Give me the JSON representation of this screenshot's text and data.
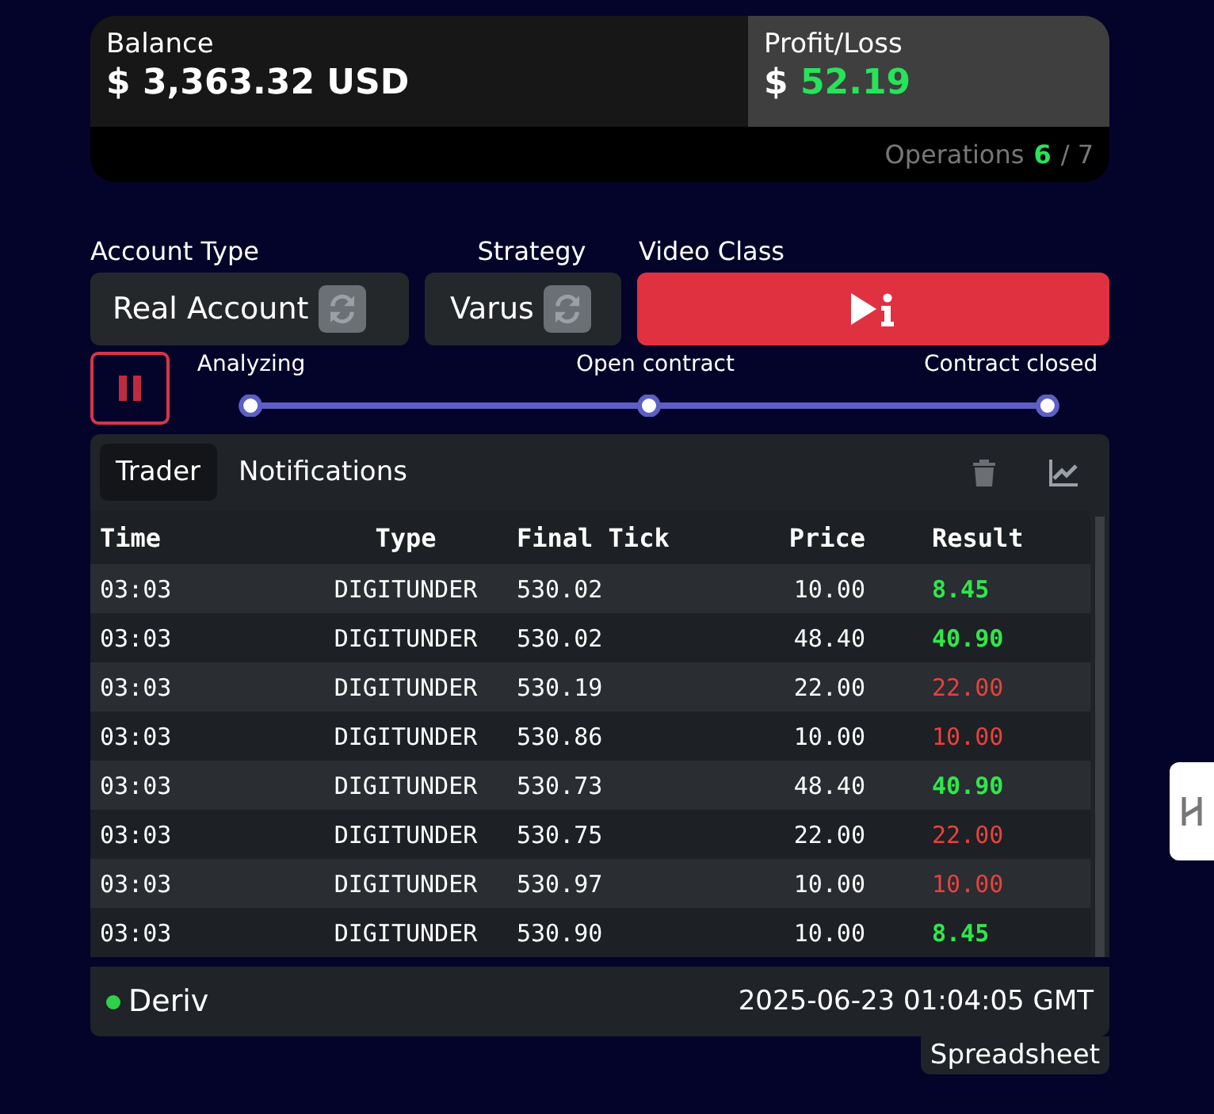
{
  "balance": {
    "label": "Balance",
    "value": "$ 3,363.32 USD"
  },
  "profit": {
    "label": "Profit/Loss",
    "currency": "$",
    "value": "52.19"
  },
  "operations": {
    "label": "Operations",
    "done": "6",
    "total": "/ 7"
  },
  "account_type": {
    "label": "Account Type",
    "value": "Real Account"
  },
  "strategy": {
    "label": "Strategy",
    "value": "Varus"
  },
  "video_class": {
    "label": "Video Class"
  },
  "progress": {
    "steps": [
      "Analyzing",
      "Open contract",
      "Contract closed"
    ]
  },
  "tabs": [
    {
      "label": "Trader",
      "selected": true
    },
    {
      "label": "Notifications",
      "selected": false
    }
  ],
  "table": {
    "columns": [
      "Time",
      "Type",
      "Final Tick",
      "Price",
      "Result"
    ],
    "rows": [
      {
        "time": "03:03",
        "type": "DIGITUNDER",
        "tick": "530.02",
        "price": "10.00",
        "result": "8.45",
        "kind": "win"
      },
      {
        "time": "03:03",
        "type": "DIGITUNDER",
        "tick": "530.02",
        "price": "48.40",
        "result": "40.90",
        "kind": "win"
      },
      {
        "time": "03:03",
        "type": "DIGITUNDER",
        "tick": "530.19",
        "price": "22.00",
        "result": "22.00",
        "kind": "loss"
      },
      {
        "time": "03:03",
        "type": "DIGITUNDER",
        "tick": "530.86",
        "price": "10.00",
        "result": "10.00",
        "kind": "loss"
      },
      {
        "time": "03:03",
        "type": "DIGITUNDER",
        "tick": "530.73",
        "price": "48.40",
        "result": "40.90",
        "kind": "win"
      },
      {
        "time": "03:03",
        "type": "DIGITUNDER",
        "tick": "530.75",
        "price": "22.00",
        "result": "22.00",
        "kind": "loss"
      },
      {
        "time": "03:03",
        "type": "DIGITUNDER",
        "tick": "530.97",
        "price": "10.00",
        "result": "10.00",
        "kind": "loss"
      },
      {
        "time": "03:03",
        "type": "DIGITUNDER",
        "tick": "530.90",
        "price": "10.00",
        "result": "8.45",
        "kind": "win"
      }
    ]
  },
  "footer": {
    "broker": "Deriv",
    "connected": true,
    "timestamp": "2025-06-23 01:04:05 GMT"
  },
  "spreadsheet_tab": {
    "label": "Spreadsheet"
  }
}
